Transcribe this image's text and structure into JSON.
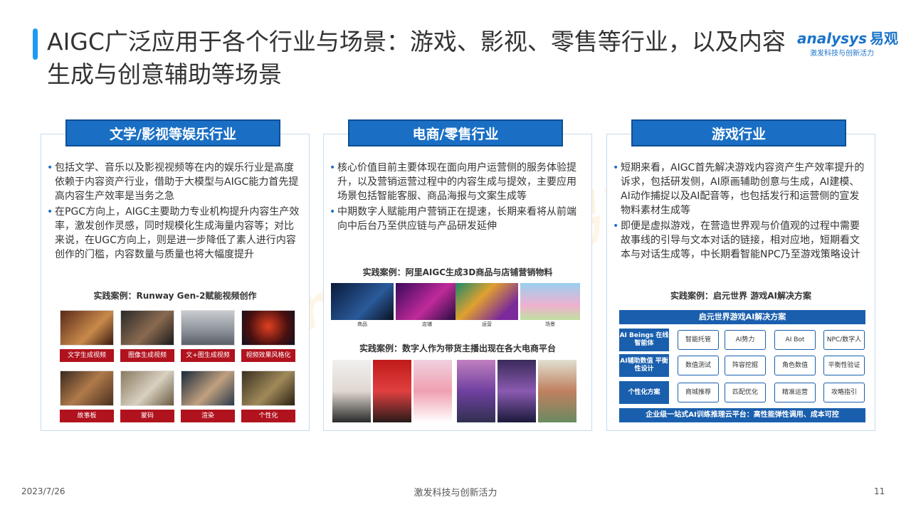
{
  "header": {
    "title": "AIGC广泛应用于各个行业与场景：游戏、影视、零售等行业，以及内容生成与创意辅助等场景"
  },
  "logo": {
    "main": "nalysys",
    "main_prefix": "a",
    "cn": "易观",
    "sub": "激发科技与创新活力"
  },
  "watermark": "nalysys 易观分析",
  "panels": [
    {
      "heading": "文学/影视等娱乐行业",
      "bullets": [
        "包括文学、音乐以及影视视频等在内的娱乐行业是高度依赖于内容资产行业，借助于大模型与AIGC能力首先提高内容生产效率是当务之急",
        "在PGC方向上，AIGC主要助力专业机构提升内容生产效率，激发创作灵感，同时规模化生成海量内容等；对比来说，在UGC方向上，则是进一步降低了素人进行内容创作的门槛，内容数量与质量也将大幅度提升"
      ],
      "case_label": "实践案例：Runway   Gen-2赋能视频创作",
      "thumb_captions": [
        "文字生成视频",
        "图像生成视频",
        "文+图生成视频",
        "视频效果风格化",
        "故事板",
        "蒙码",
        "渲染",
        "个性化"
      ]
    },
    {
      "heading": "电商/零售行业",
      "bullets": [
        "核心价值目前主要体现在面向用户运营侧的服务体验提升，以及营销运营过程中的内容生成与提效，主要应用场景包括智能客服、商品海报与文案生成等",
        "中期数字人赋能用户营销正在提速，长期来看将从前端向中后台乃至供应链与产品研发延伸"
      ],
      "case_label_1": "实践案例：阿里AIGC生成3D商品与店铺营销物料",
      "case_label_2": "实践案例：数字人作为带货主播出现在各大电商平台",
      "shot_captions": [
        "商品",
        "店铺",
        "运营",
        "场景"
      ]
    },
    {
      "heading": "游戏行业",
      "bullets": [
        "短期来看，AIGC首先解决游戏内容资产生产效率提升的诉求，包括研发侧，AI原画辅助创意与生成，AI建模、AI动作捕捉以及AI配音等，也包括发行和运营侧的宣发物料素材生成等",
        "即便是虚拟游戏，在营造世界观与价值观的过程中需要故事线的引导与文本对话的链接，相对应地，短期看文本与对话生成等，中长期看智能NPC乃至游戏策略设计"
      ],
      "case_label": "实践案例：启元世界 游戏AI解决方案",
      "solution": {
        "title": "启元世界游戏AI解决方案",
        "rows": [
          {
            "category": "AI Beings 在线智能体",
            "cells": [
              "智能托管",
              "AI势力",
              "AI Bot",
              "NPC/数字人"
            ]
          },
          {
            "category": "AI辅助数值 平衡性设计",
            "cells": [
              "数值测试",
              "阵容挖掘",
              "角色数值",
              "平衡性验证"
            ]
          },
          {
            "category": "个性化方案",
            "cells": [
              "商城推荐",
              "匹配优化",
              "精准运营",
              "攻略指引"
            ]
          }
        ],
        "footer": "企业级一站式AI训练推理云平台：高性能弹性调用、成本可控"
      }
    }
  ],
  "footer": {
    "date": "2023/7/26",
    "slogan": "激发科技与创新活力",
    "page": "11"
  }
}
